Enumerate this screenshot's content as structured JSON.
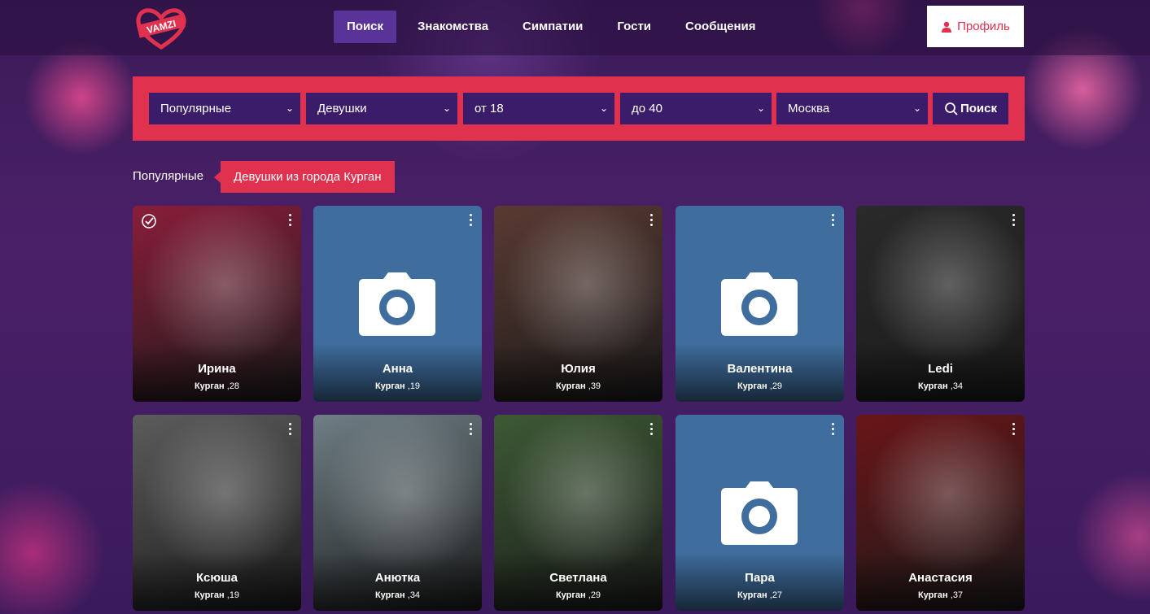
{
  "logo": {
    "text": "VAMZI"
  },
  "nav": [
    {
      "label": "Поиск",
      "active": true
    },
    {
      "label": "Знакомства",
      "active": false
    },
    {
      "label": "Симпатии",
      "active": false
    },
    {
      "label": "Гости",
      "active": false
    },
    {
      "label": "Сообщения",
      "active": false
    }
  ],
  "profile": {
    "label": "Профиль"
  },
  "search": {
    "sort": "Популярные",
    "gender": "Девушки",
    "age_from": "от 18",
    "age_to": "до 40",
    "city": "Москва",
    "button_label": "Поиск"
  },
  "breadcrumb": {
    "first": "Популярные",
    "active": "Девушки из города Курган"
  },
  "cards": [
    {
      "name": "Ирина",
      "city": "Курган",
      "age": "28",
      "has_photo": true,
      "verified": true,
      "tone": "#8a1d3a"
    },
    {
      "name": "Анна",
      "city": "Курган",
      "age": "19",
      "has_photo": false,
      "verified": false,
      "tone": "#3f6d9d"
    },
    {
      "name": "Юлия",
      "city": "Курган",
      "age": "39",
      "has_photo": true,
      "verified": false,
      "tone": "#5a3a32"
    },
    {
      "name": "Валентина",
      "city": "Курган",
      "age": "29",
      "has_photo": false,
      "verified": false,
      "tone": "#3f6d9d"
    },
    {
      "name": "Ledi",
      "city": "Курган",
      "age": "34",
      "has_photo": true,
      "verified": false,
      "tone": "#2a2a2a"
    },
    {
      "name": "Ксюша",
      "city": "Курган",
      "age": "19",
      "has_photo": true,
      "verified": false,
      "tone": "#5c5c5c"
    },
    {
      "name": "Анютка",
      "city": "Курган",
      "age": "34",
      "has_photo": true,
      "verified": false,
      "tone": "#6f7f86"
    },
    {
      "name": "Светлана",
      "city": "Курган",
      "age": "29",
      "has_photo": true,
      "verified": false,
      "tone": "#3d5a34"
    },
    {
      "name": "Пара",
      "city": "Курган",
      "age": "27",
      "has_photo": false,
      "verified": false,
      "tone": "#3f6d9d"
    },
    {
      "name": "Анастасия",
      "city": "Курган",
      "age": "37",
      "has_photo": true,
      "verified": false,
      "tone": "#6a1518"
    }
  ],
  "colors": {
    "accent": "#e0314f",
    "nav_active": "#5a3398",
    "select_bg": "#3b1c6b",
    "placeholder_bg": "#3f6d9d"
  }
}
